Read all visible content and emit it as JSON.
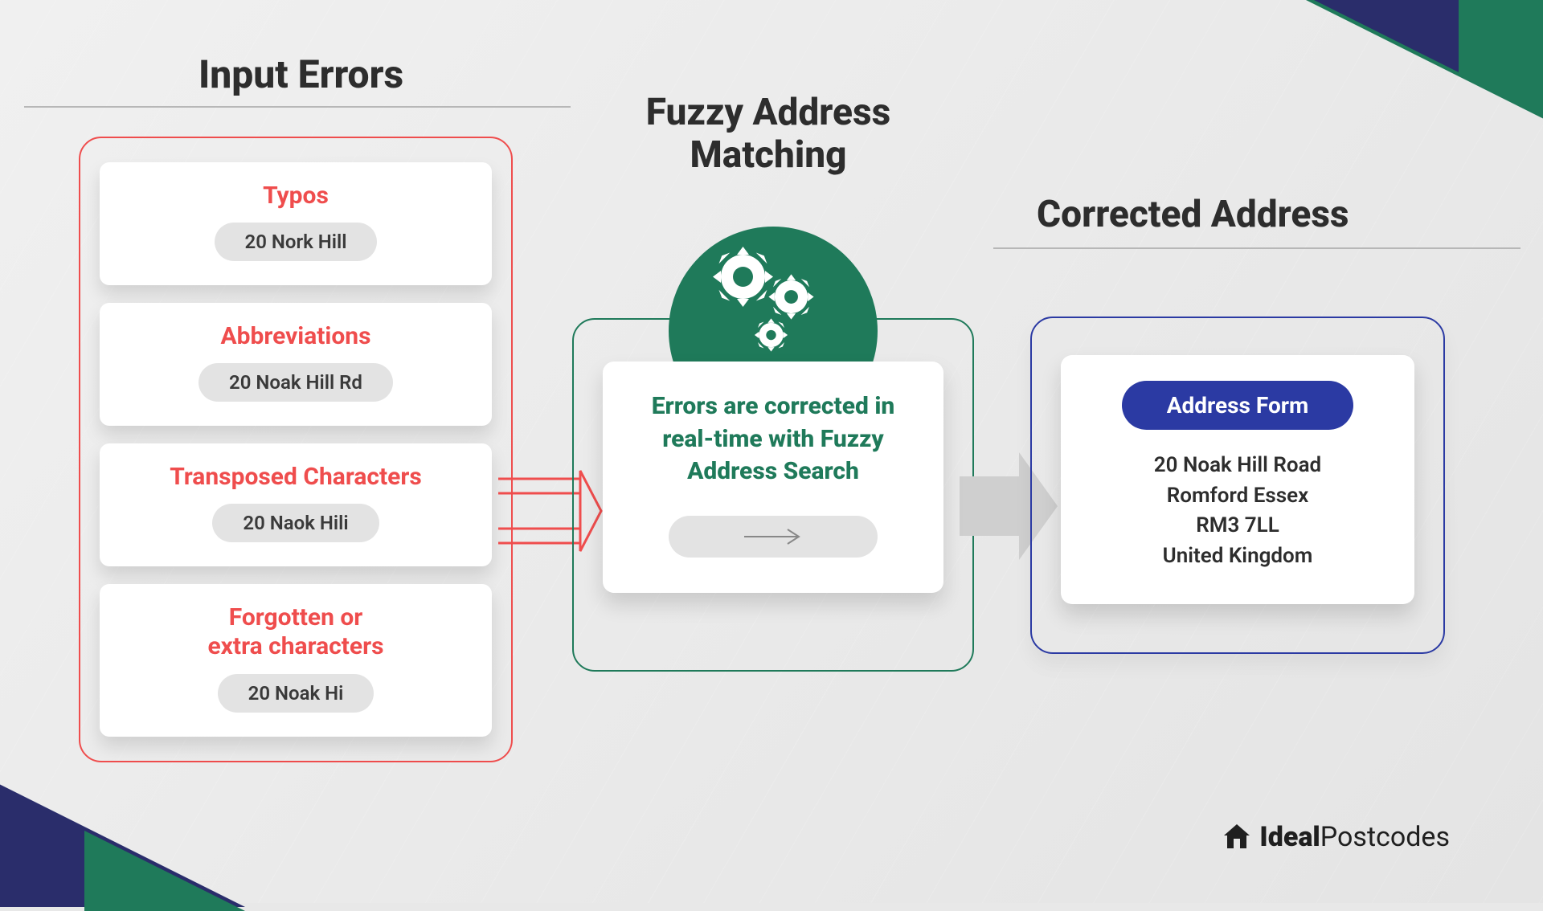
{
  "headings": {
    "input_errors": "Input Errors",
    "fuzzy": "Fuzzy Address Matching",
    "corrected": "Corrected Address"
  },
  "errors": [
    {
      "title": "Typos",
      "example": "20 Nork Hill"
    },
    {
      "title": "Abbreviations",
      "example": "20 Noak Hill Rd"
    },
    {
      "title": "Transposed Characters",
      "example": "20 Naok Hili"
    },
    {
      "title": "Forgotten or\nextra characters",
      "example": "20 Noak Hi"
    }
  ],
  "middle": {
    "description": "Errors are corrected in real-time with Fuzzy Address Search"
  },
  "result": {
    "form_label": "Address Form",
    "lines": [
      "20 Noak Hill Road",
      "Romford Essex",
      "RM3 7LL",
      "United Kingdom"
    ]
  },
  "brand": {
    "bold": "Ideal",
    "light": "Postcodes"
  },
  "colors": {
    "red": "#ef4d4d",
    "green": "#1f7a5a",
    "blue": "#2b3aa3",
    "navy": "#2a2d6b"
  }
}
